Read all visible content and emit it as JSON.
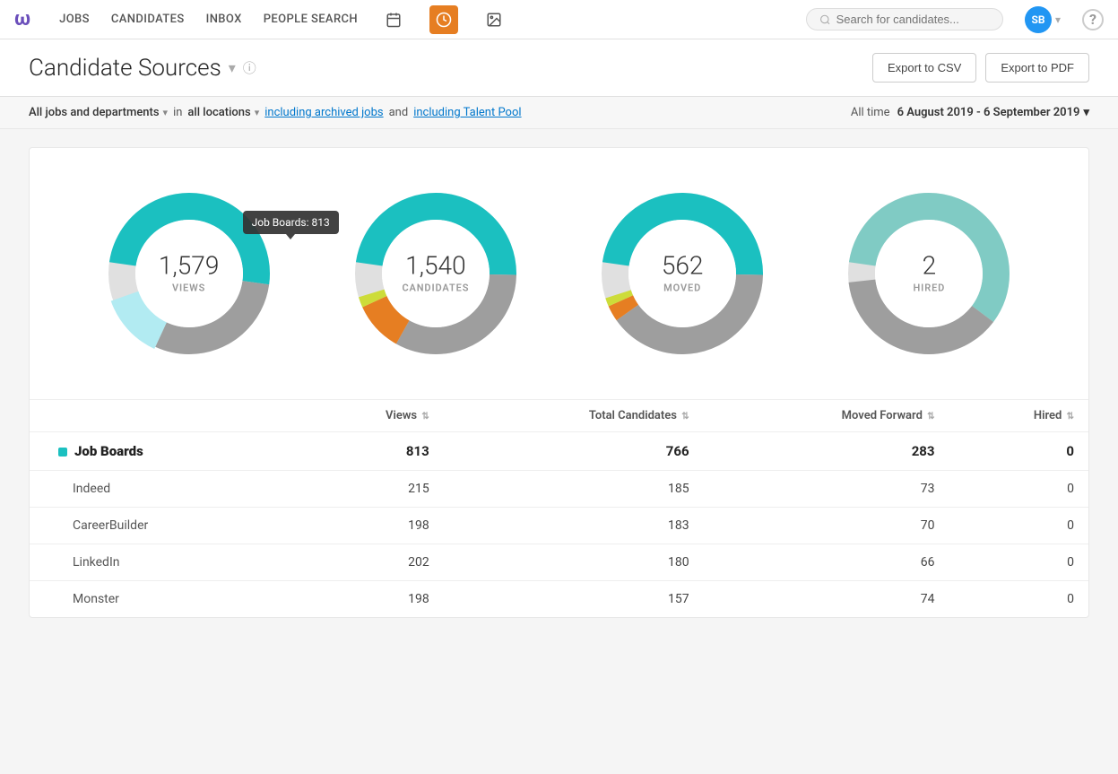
{
  "nav": {
    "logo": "w",
    "links": [
      {
        "label": "JOBS",
        "active": false
      },
      {
        "label": "CANDIDATES",
        "active": false
      },
      {
        "label": "INBOX",
        "active": false
      },
      {
        "label": "PEOPLE SEARCH",
        "active": false
      }
    ],
    "icons": [
      {
        "name": "calendar-icon",
        "symbol": "📅",
        "active": false
      },
      {
        "name": "clock-icon",
        "symbol": "⏱",
        "active": true
      },
      {
        "name": "image-icon",
        "symbol": "🖼",
        "active": false
      }
    ],
    "search_placeholder": "Search for candidates...",
    "avatar_initials": "SB",
    "help_label": "?"
  },
  "page": {
    "title": "Candidate Sources",
    "export_csv": "Export to CSV",
    "export_pdf": "Export to PDF"
  },
  "filters": {
    "jobs_label": "All jobs and departments",
    "in_text": "in",
    "locations_label": "all locations",
    "archived_link": "including archived jobs",
    "and_text": "and",
    "talent_pool_link": "including Talent Pool",
    "time_label": "All time",
    "date_range": "6 August 2019 - 6 September 2019"
  },
  "tooltip": {
    "text": "Job Boards: 813"
  },
  "charts": [
    {
      "value": "1,579",
      "label": "VIEWS"
    },
    {
      "value": "1,540",
      "label": "CANDIDATES"
    },
    {
      "value": "562",
      "label": "MOVED"
    },
    {
      "value": "2",
      "label": "HIRED"
    }
  ],
  "table": {
    "columns": [
      "Views",
      "Total Candidates",
      "Moved Forward",
      "Hired"
    ],
    "groups": [
      {
        "name": "Job Boards",
        "color": "#1bc0c0",
        "views": "813",
        "candidates": "766",
        "moved": "283",
        "hired": "0",
        "rows": [
          {
            "name": "Indeed",
            "views": "215",
            "candidates": "185",
            "moved": "73",
            "hired": "0"
          },
          {
            "name": "CareerBuilder",
            "views": "198",
            "candidates": "183",
            "moved": "70",
            "hired": "0"
          },
          {
            "name": "LinkedIn",
            "views": "202",
            "candidates": "180",
            "moved": "66",
            "hired": "0"
          },
          {
            "name": "Monster",
            "views": "198",
            "candidates": "157",
            "moved": "74",
            "hired": "0"
          }
        ]
      }
    ]
  }
}
